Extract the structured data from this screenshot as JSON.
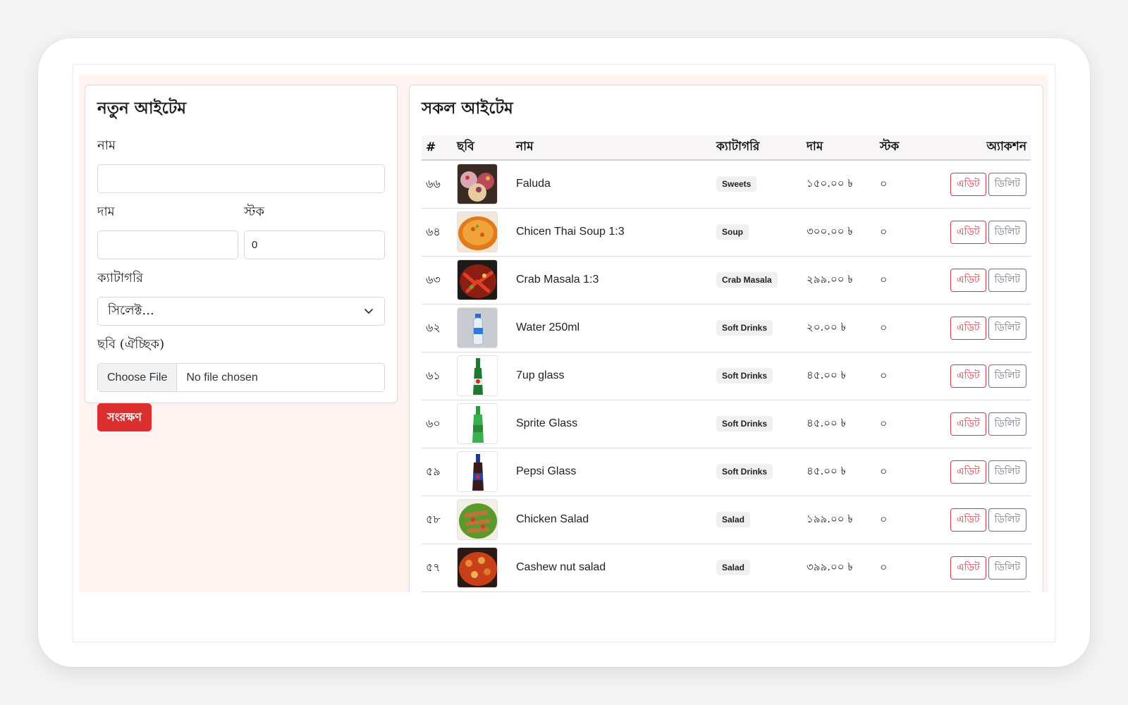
{
  "form": {
    "title": "নতুন আইটেম",
    "name_label": "নাম",
    "name_value": "",
    "price_label": "দাম",
    "price_value": "",
    "stock_label": "স্টক",
    "stock_value": "0",
    "category_label": "ক্যাটাগরি",
    "category_selected": "সিলেক্ট...",
    "image_label": "ছবি (ঐচ্ছিক)",
    "file_button": "Choose File",
    "file_status": "No file chosen",
    "save_label": "সংরক্ষণ"
  },
  "list": {
    "title": "সকল আইটেম",
    "headers": {
      "num": "#",
      "image": "ছবি",
      "name": "নাম",
      "category": "ক্যাটাগরি",
      "price": "দাম",
      "stock": "স্টক",
      "action": "অ্যাকশন"
    },
    "edit_label": "এডিট",
    "delete_label": "ডিলিট",
    "rows": [
      {
        "num": "৬৬",
        "name": "Faluda",
        "category": "Sweets",
        "price": "১৫০.০০ ৳",
        "stock": "০",
        "image_icon": "faluda-image"
      },
      {
        "num": "৬৪",
        "name": "Chicen Thai Soup 1:3",
        "category": "Soup",
        "price": "৩০০.০০ ৳",
        "stock": "০",
        "image_icon": "soup-image"
      },
      {
        "num": "৬৩",
        "name": "Crab Masala 1:3",
        "category": "Crab Masala",
        "price": "২৯৯.০০ ৳",
        "stock": "০",
        "image_icon": "crab-image"
      },
      {
        "num": "৬২",
        "name": "Water 250ml",
        "category": "Soft Drinks",
        "price": "২০.০০ ৳",
        "stock": "০",
        "image_icon": "water-bottle-image"
      },
      {
        "num": "৬১",
        "name": "7up glass",
        "category": "Soft Drinks",
        "price": "৪৫.০০ ৳",
        "stock": "০",
        "image_icon": "7up-bottle-image"
      },
      {
        "num": "৬০",
        "name": "Sprite Glass",
        "category": "Soft Drinks",
        "price": "৪৫.০০ ৳",
        "stock": "০",
        "image_icon": "sprite-bottle-image"
      },
      {
        "num": "৫৯",
        "name": "Pepsi Glass",
        "category": "Soft Drinks",
        "price": "৪৫.০০ ৳",
        "stock": "০",
        "image_icon": "pepsi-bottle-image"
      },
      {
        "num": "৫৮",
        "name": "Chicken Salad",
        "category": "Salad",
        "price": "১৯৯.০০ ৳",
        "stock": "০",
        "image_icon": "chicken-salad-image"
      },
      {
        "num": "৫৭",
        "name": "Cashew nut salad",
        "category": "Salad",
        "price": "৩৯৯.০০ ৳",
        "stock": "০",
        "image_icon": "cashew-salad-image"
      }
    ]
  },
  "colors": {
    "accent": "#dc3030",
    "page_bg": "#fff3f2",
    "edit": "#dc3545",
    "delete": "#6c757d"
  }
}
